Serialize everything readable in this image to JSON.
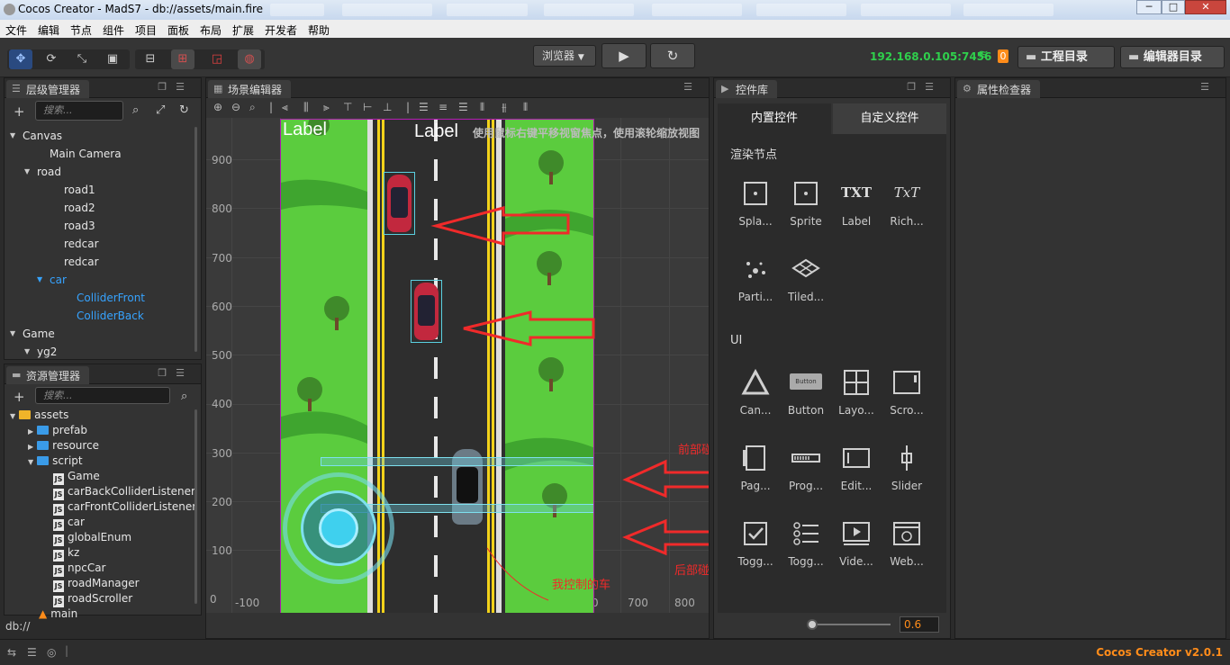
{
  "window": {
    "title": "Cocos Creator - MadS7 - db://assets/main.fire",
    "min": "─",
    "max": "□",
    "close": "✕"
  },
  "menu": [
    "文件",
    "编辑",
    "节点",
    "组件",
    "项目",
    "面板",
    "布局",
    "扩展",
    "开发者",
    "帮助"
  ],
  "toolbar": {
    "preview_select": "浏览器",
    "play_icon": "▶",
    "refresh_icon": "↻",
    "ip": "192.168.0.105:7456",
    "badge_count": "0",
    "project_dir": "工程目录",
    "editor_dir": "编辑器目录"
  },
  "hierarchy": {
    "title": "层级管理器",
    "search_placeholder": "搜索...",
    "nodes": [
      {
        "label": "Canvas",
        "expanded": true,
        "highlight": false
      },
      {
        "label": "Main Camera",
        "expanded": null,
        "highlight": false
      },
      {
        "label": "road",
        "expanded": true,
        "highlight": false
      },
      {
        "label": "road1",
        "expanded": null,
        "highlight": false
      },
      {
        "label": "road2",
        "expanded": null,
        "highlight": false
      },
      {
        "label": "road3",
        "expanded": null,
        "highlight": false
      },
      {
        "label": "redcar",
        "expanded": null,
        "highlight": false
      },
      {
        "label": "redcar",
        "expanded": null,
        "highlight": false
      },
      {
        "label": "car",
        "expanded": true,
        "highlight": true
      },
      {
        "label": "ColliderFront",
        "expanded": null,
        "highlight": true
      },
      {
        "label": "ColliderBack",
        "expanded": null,
        "highlight": true
      },
      {
        "label": "Game",
        "expanded": true,
        "highlight": false
      },
      {
        "label": "yg2",
        "expanded": true,
        "highlight": false
      }
    ]
  },
  "assets": {
    "title": "资源管理器",
    "search_placeholder": "搜索...",
    "items": [
      {
        "label": "assets",
        "kind": "root"
      },
      {
        "label": "prefab",
        "kind": "folder"
      },
      {
        "label": "resource",
        "kind": "folder"
      },
      {
        "label": "script",
        "kind": "folder-open"
      },
      {
        "label": "Game",
        "kind": "js"
      },
      {
        "label": "carBackColliderListener",
        "kind": "js"
      },
      {
        "label": "carFrontColliderListener",
        "kind": "js"
      },
      {
        "label": "car",
        "kind": "js"
      },
      {
        "label": "globalEnum",
        "kind": "js"
      },
      {
        "label": "kz",
        "kind": "js"
      },
      {
        "label": "npcCar",
        "kind": "js"
      },
      {
        "label": "roadManager",
        "kind": "js"
      },
      {
        "label": "roadScroller",
        "kind": "js"
      },
      {
        "label": "main",
        "kind": "scene"
      }
    ],
    "db_path": "db://",
    "js_tag": "JS"
  },
  "scene": {
    "title": "场景编辑器",
    "hint": "使用鼠标右键平移视窗焦点，使用滚轮缩放视图",
    "y_ticks": [
      "900",
      "800",
      "700",
      "600",
      "500",
      "400",
      "300",
      "200",
      "100",
      "0"
    ],
    "x_ticks": [
      "-100",
      "0",
      "700",
      "800"
    ],
    "label_left": "Label",
    "label_center": "Label",
    "annotations": {
      "front": "前部碰撞检测",
      "back": "后部碰撞检测",
      "my_car": "我控制的车"
    }
  },
  "widgets": {
    "title": "控件库",
    "tab_builtin": "内置控件",
    "tab_custom": "自定义控件",
    "section_render": "渲染节点",
    "section_ui": "UI",
    "render_items": [
      {
        "label": "Spla...",
        "icon": "splash-sprite-icon"
      },
      {
        "label": "Sprite",
        "icon": "sprite-icon"
      },
      {
        "label": "Label",
        "icon": "label-icon",
        "glyph": "TXT"
      },
      {
        "label": "Rich...",
        "icon": "richtext-icon",
        "glyph": "TxT"
      },
      {
        "label": "Parti...",
        "icon": "particle-icon"
      },
      {
        "label": "Tiled...",
        "icon": "tiledmap-icon"
      }
    ],
    "ui_items": [
      {
        "label": "Can...",
        "icon": "canvas-icon"
      },
      {
        "label": "Button",
        "icon": "button-icon",
        "glyph": "Button"
      },
      {
        "label": "Layo...",
        "icon": "layout-icon"
      },
      {
        "label": "Scro...",
        "icon": "scrollview-icon"
      },
      {
        "label": "Pag...",
        "icon": "pageview-icon"
      },
      {
        "label": "Prog...",
        "icon": "progressbar-icon"
      },
      {
        "label": "Edit...",
        "icon": "editbox-icon"
      },
      {
        "label": "Slider",
        "icon": "slider-icon"
      },
      {
        "label": "Togg...",
        "icon": "toggle-icon"
      },
      {
        "label": "Togg...",
        "icon": "togglegroup-icon"
      },
      {
        "label": "Vide...",
        "icon": "videoplayer-icon"
      },
      {
        "label": "Web...",
        "icon": "webview-icon"
      }
    ],
    "zoom_value": "0.6",
    "zoom_fraction": 0.05
  },
  "inspector": {
    "title": "属性检查器"
  },
  "status": {
    "version": "Cocos Creator v2.0.1"
  },
  "colors": {
    "accent_blue": "#2a4a80",
    "ip_green": "#2fd04c",
    "version_orange": "#ff8c1a",
    "annotation_red": "#f02a2a",
    "grass_green": "#5bcc3e"
  }
}
